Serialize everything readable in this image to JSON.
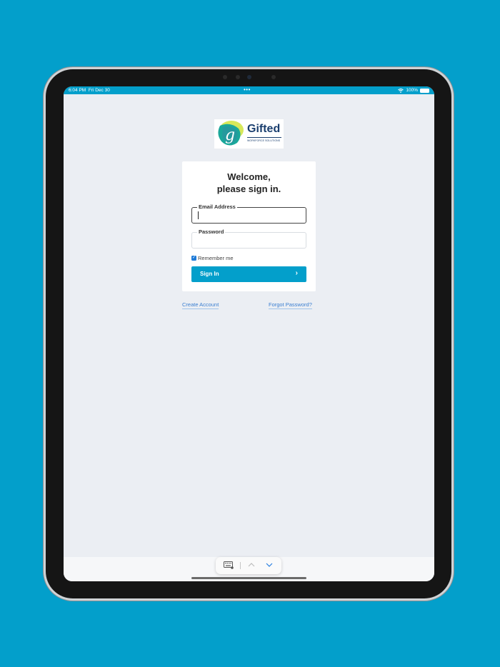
{
  "status_bar": {
    "time": "6:04 PM",
    "date": "Fri Dec 30",
    "multitask_dots": "•••",
    "battery_text": "100%"
  },
  "logo": {
    "name": "Gifted",
    "tagline": "WORKFORCE SOLUTIONS",
    "letter": "g"
  },
  "login": {
    "title_line1": "Welcome,",
    "title_line2": "please sign in.",
    "email_label": "Email Address",
    "email_value": "",
    "password_label": "Password",
    "password_value": "",
    "remember_label": "Remember me",
    "remember_checked": true,
    "signin_label": "Sign In",
    "signin_chevron": "›"
  },
  "links": {
    "create_account": "Create Account",
    "forgot_password": "Forgot Password?"
  },
  "colors": {
    "background": "#039fcb",
    "accent": "#039fcb",
    "link": "#3b7fd1",
    "screen": "#ebeef3"
  },
  "icons": {
    "wifi": "wifi-icon",
    "battery": "battery-icon",
    "keyboard": "keyboard-dismiss-icon",
    "up": "chevron-up-icon",
    "down": "chevron-down-icon",
    "checkbox": "checkmark-icon"
  }
}
